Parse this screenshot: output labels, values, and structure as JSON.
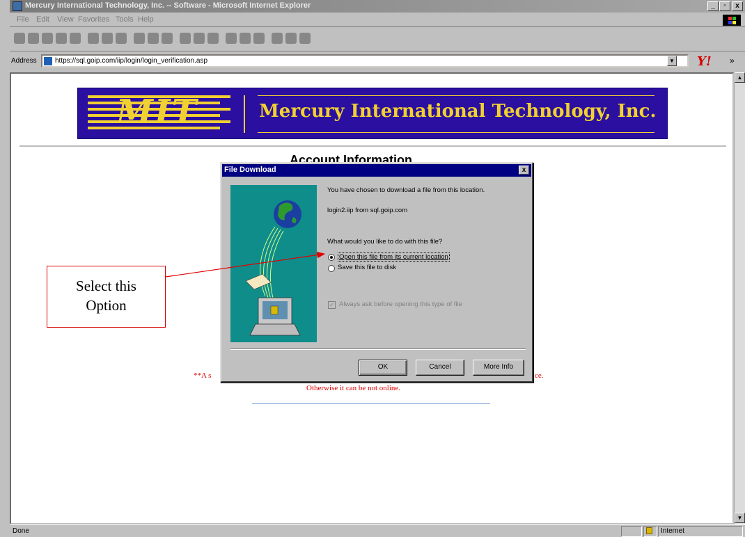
{
  "window": {
    "title": "Mercury International Technology, Inc. -- Software - Microsoft Internet Explorer",
    "controls": [
      "_",
      "▫",
      "x"
    ]
  },
  "menubar": {
    "items": [
      "File",
      "Edit",
      "View",
      "Favorites",
      "Tools",
      "Help"
    ]
  },
  "addressbar": {
    "label": "Address",
    "url": "https://sql.goip.com/iip/login/login_verification.asp",
    "dropdown": "▼",
    "more": "»",
    "yahoo": "Y!"
  },
  "page": {
    "company": "Mercury International Technology, Inc.",
    "logo_text": "MIT",
    "heading": "Account Information",
    "note_left": "**A s",
    "note_right": "ce.",
    "note_line2": "Otherwise it can be not online."
  },
  "dialog": {
    "title": "File Download",
    "close": "x",
    "intro": "You have chosen to download a file from this location.",
    "filename": "login2.iip from sql.goip.com",
    "question": "What would you like to do with this file?",
    "option_open": "Open this file from its current location",
    "option_save": "Save this file to disk",
    "always_ask": "Always ask before opening this type of file",
    "buttons": {
      "ok": "OK",
      "cancel": "Cancel",
      "more": "More Info"
    }
  },
  "callout": {
    "line1": "Select this",
    "line2": "Option"
  },
  "statusbar": {
    "text": "Done",
    "zone": "Internet"
  },
  "colors": {
    "banner_bg": "#2a0fa0",
    "banner_gold": "#f1d032",
    "dialog_title": "#000082",
    "callout_red": "#d40000"
  }
}
